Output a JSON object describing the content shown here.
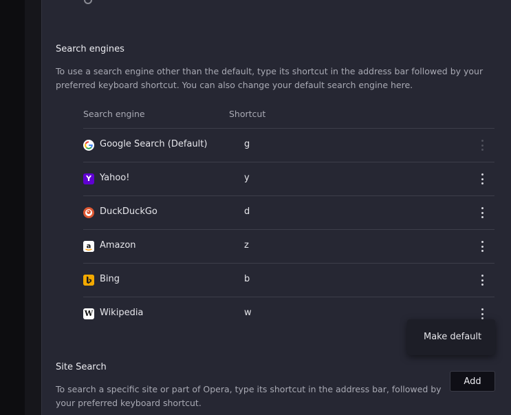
{
  "search_engines": {
    "title": "Search engines",
    "description": "To use a search engine other than the default, type its shortcut in the address bar followed by your preferred keyboard shortcut. You can also change your default search engine here.",
    "columns": {
      "engine": "Search engine",
      "shortcut": "Shortcut"
    },
    "rows": [
      {
        "name": "Google Search (Default)",
        "shortcut": "g",
        "icon": "google-icon"
      },
      {
        "name": "Yahoo!",
        "shortcut": "y",
        "icon": "yahoo-icon"
      },
      {
        "name": "DuckDuckGo",
        "shortcut": "d",
        "icon": "duckduckgo-icon"
      },
      {
        "name": "Amazon",
        "shortcut": "z",
        "icon": "amazon-icon"
      },
      {
        "name": "Bing",
        "shortcut": "b",
        "icon": "bing-icon"
      },
      {
        "name": "Wikipedia",
        "shortcut": "w",
        "icon": "wikipedia-icon"
      }
    ]
  },
  "context_menu": {
    "make_default": "Make default"
  },
  "site_search": {
    "title": "Site Search",
    "description": "To search a specific site or part of Opera, type its shortcut in the address bar, followed by your preferred keyboard shortcut.",
    "add_label": "Add"
  },
  "colors": {
    "panel_bg": "#262733",
    "page_bg": "#121217",
    "divider": "#3d3e4a",
    "text_primary": "#e6e6eb",
    "text_secondary": "#a9aab4"
  }
}
